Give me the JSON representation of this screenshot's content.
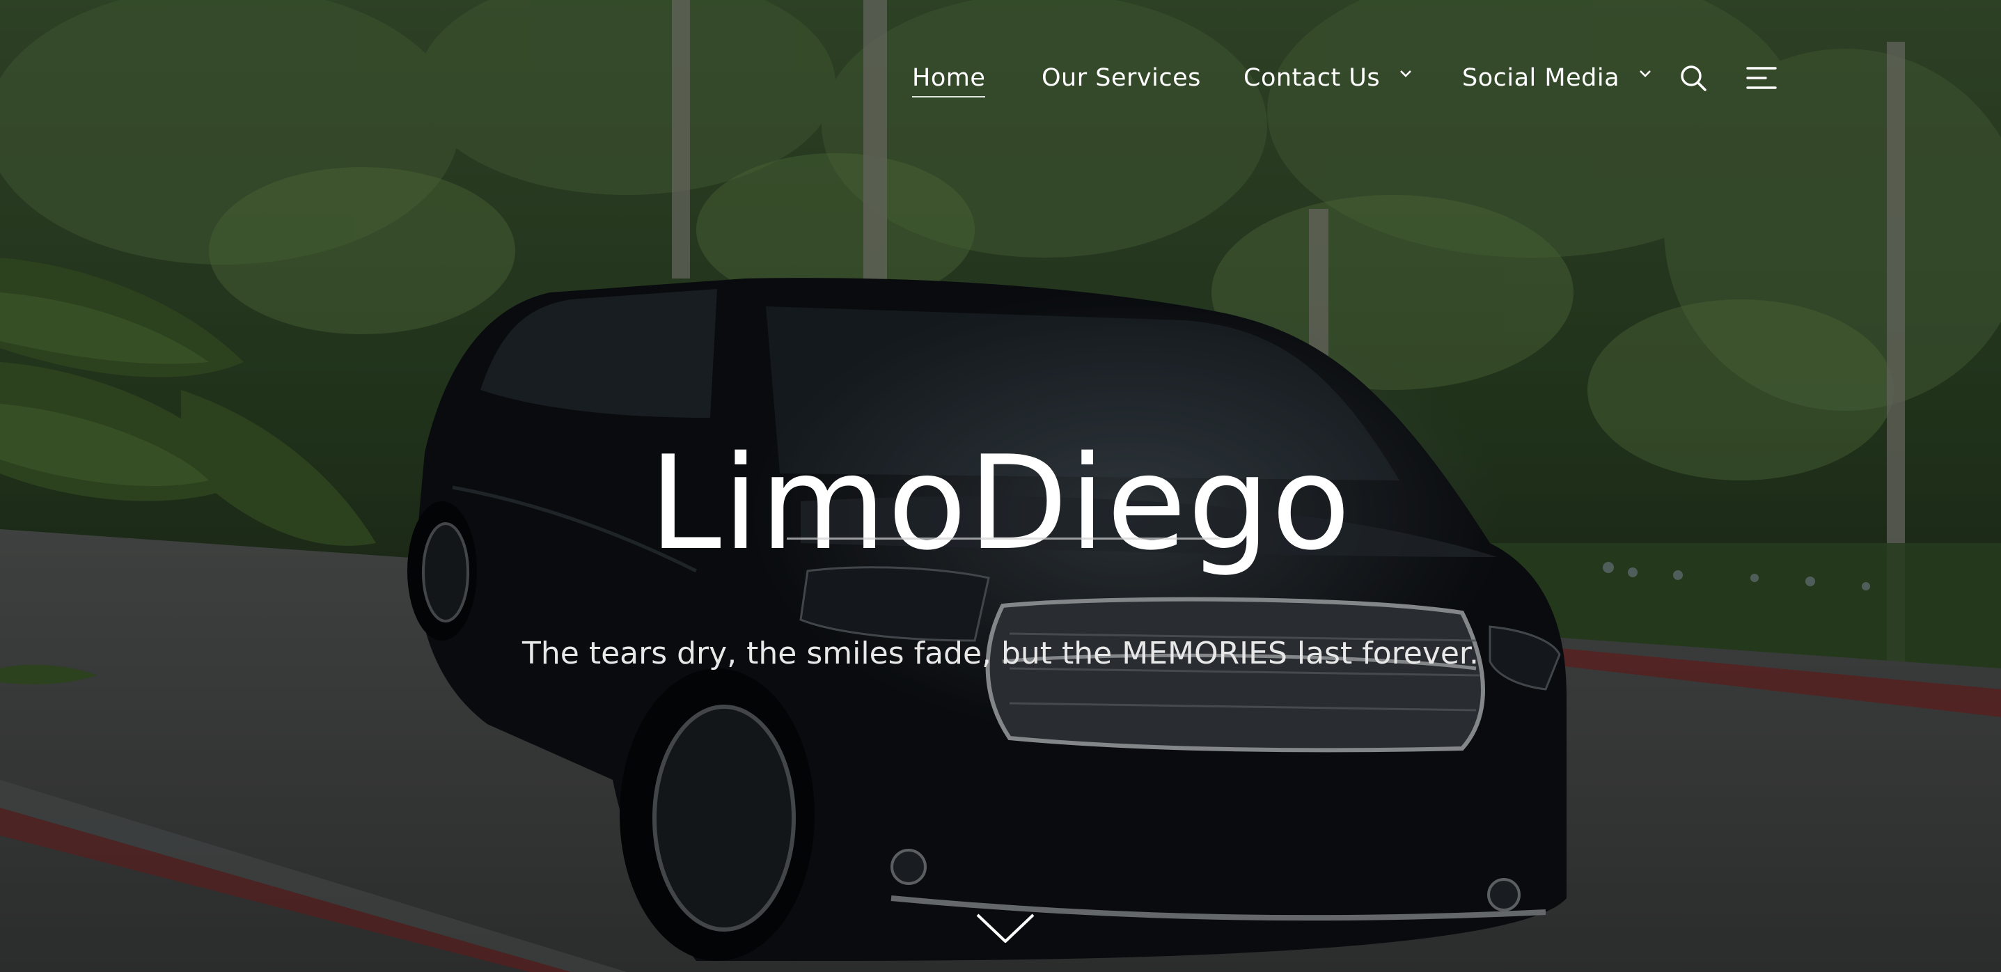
{
  "nav": {
    "items": [
      {
        "label": "Home",
        "active": true
      },
      {
        "label": "Our Services"
      },
      {
        "label": "Contact Us",
        "dropdown": true
      },
      {
        "label": "Social Media",
        "dropdown": true
      }
    ],
    "icons": {
      "search": "search-icon",
      "menu": "menu-icon"
    }
  },
  "hero": {
    "title": "LimoDiego",
    "tagline": "The tears dry, the smiles fade, but the MEMORIES last forever.",
    "scroll_icon": "chevron-down-icon"
  },
  "colors": {
    "text": "#ffffff",
    "tagline": "#e8e8e8",
    "divider": "#c8c8c8",
    "foliage": "#2e4a26",
    "road": "#4a4c4c",
    "curb": "#8a2a2a",
    "vehicle": "#0d1014"
  }
}
